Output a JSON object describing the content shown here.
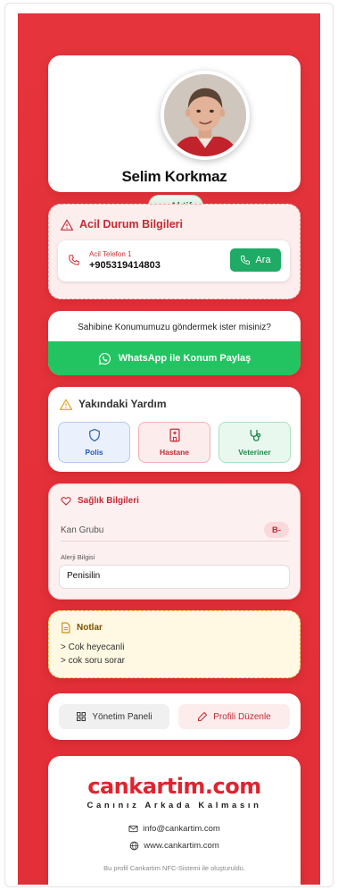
{
  "profile": {
    "name": "Selim Korkmaz",
    "status": "Aktif"
  },
  "emergency": {
    "title": "Acil Durum Bilgileri",
    "phone_label": "Acil Telefon 1",
    "phone_number": "+905319414803",
    "call_label": "Ara"
  },
  "location": {
    "question": "Sahibine Konumumuzu göndermek ister misiniz?",
    "whatsapp_label": "WhatsApp ile Konum Paylaş"
  },
  "help": {
    "title": "Yakındaki Yardım",
    "police": "Polis",
    "hospital": "Hastane",
    "vet": "Veteriner"
  },
  "health": {
    "title": "Sağlık Bilgileri",
    "blood_label": "Kan Grubu",
    "blood_value": "B-",
    "allergy_label": "Alerji Bilgisi",
    "allergy_value": "Penisilin"
  },
  "notes": {
    "title": "Notlar",
    "lines": [
      "> Cok heyecanli",
      "> cok soru sorar"
    ]
  },
  "actions": {
    "panel_label": "Yönetim Paneli",
    "edit_label": "Profili Düzenle"
  },
  "footer": {
    "brand": "cankartim.com",
    "tagline": "Canınız Arkada Kalmasın",
    "email": "info@cankartim.com",
    "website": "www.cankartim.com",
    "note": "Bu profil Cankartim NFC-Sistemi ile oluşturuldu."
  },
  "colors": {
    "brand_red": "#e5343c",
    "whatsapp_green": "#22c461",
    "call_green": "#1faa65"
  }
}
